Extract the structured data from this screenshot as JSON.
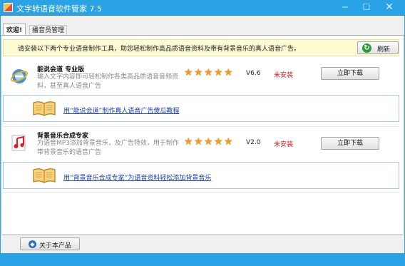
{
  "window": {
    "title": "文字转语音软件管家 7.5"
  },
  "tabs": [
    {
      "label": "欢迎!"
    },
    {
      "label": "播音员管理"
    }
  ],
  "notice": {
    "text": "请安装以下两个专业语音制作工具，助您轻松制作高品质语音资料及带有背景音乐的真人语音广告。",
    "refresh_label": "刷新",
    "refresh_icon": "refresh-icon"
  },
  "products": [
    {
      "name": "能说会道 专业版",
      "description": "输入文字内容即可轻松制作各类高品质语音音频资料，甚至真人语音广告",
      "rating": 5,
      "version": "V6.6",
      "status": "未安装",
      "download_label": "立即下载",
      "icon": "ie-globe-icon",
      "tutorial_link": "用“能说会道”制作真人语音广告傻瓜教程"
    },
    {
      "name": "背景音乐合成专家",
      "description": "为语音MP3添加背景音乐，及广告特效，用于制作带背景音乐的语音广告",
      "rating": 5,
      "version": "V2.0",
      "status": "未安装",
      "download_label": "立即下载",
      "icon": "music-note-icon",
      "tutorial_link": "用“背景音乐合成专家”为语音资料轻松添加背景音乐"
    }
  ],
  "footer": {
    "about_label": "关于本产品"
  },
  "colors": {
    "titlebar": "#2aa2e6",
    "status_red": "#d42020",
    "link_blue": "#1a3fb4",
    "star_orange": "#f29c1f"
  }
}
